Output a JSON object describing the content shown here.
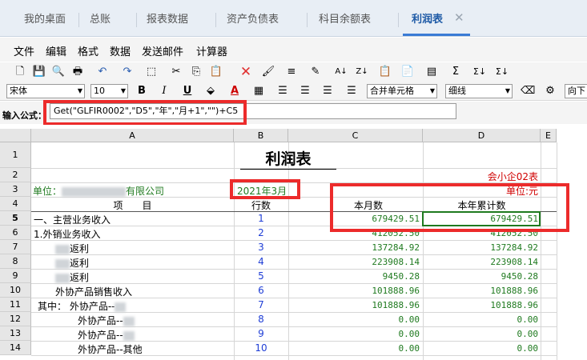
{
  "tabs": [
    {
      "label": "我的桌面"
    },
    {
      "label": "总账"
    },
    {
      "label": "报表数据"
    },
    {
      "label": "资产负债表"
    },
    {
      "label": "科目余额表"
    },
    {
      "label": "利润表",
      "active": true
    }
  ],
  "tab_close": "✕",
  "menu": [
    "文件",
    "编辑",
    "格式",
    "数据",
    "发送邮件",
    "计算器"
  ],
  "toolbar2": {
    "font": "宋体",
    "size": "10",
    "bold": "B",
    "italic": "I",
    "underline": "U",
    "merge": "合并单元格",
    "line": "细线",
    "direction": "向下"
  },
  "formula": {
    "label": "输入公式：",
    "value": "Get(\"GLFIR0002\",\"D5\",\"年\",\"月+1\",\"\")+C5"
  },
  "sheet": {
    "columns": [
      "A",
      "B",
      "C",
      "D",
      "E"
    ],
    "title": "利润表",
    "form_code": "会小企02表",
    "unit_label": "单位：",
    "unit_company_suffix": "有限公司",
    "period": "2021年3月",
    "currency_unit": "单位:元",
    "headers": {
      "item": "项　　目",
      "row_no": "行数",
      "month": "本月数",
      "ytd": "本年累计数"
    },
    "rows": [
      {
        "row": "5",
        "item": "一、主营业务收入",
        "no": "1",
        "month": "679429.51",
        "ytd": "679429.51"
      },
      {
        "row": "6",
        "item": "1.外销业务收入",
        "no": "2",
        "month": "412052.50",
        "ytd": "412052.50"
      },
      {
        "row": "7",
        "item": "返利",
        "no": "3",
        "month": "137284.92",
        "ytd": "137284.92"
      },
      {
        "row": "8",
        "item": "返利",
        "no": "4",
        "month": "223908.14",
        "ytd": "223908.14"
      },
      {
        "row": "9",
        "item": "返利",
        "no": "5",
        "month": "9450.28",
        "ytd": "9450.28"
      },
      {
        "row": "10",
        "item": "外协产品销售收入",
        "no": "6",
        "month": "101888.96",
        "ytd": "101888.96"
      },
      {
        "row": "11",
        "item": "其中：  外协产品--",
        "no": "7",
        "month": "101888.96",
        "ytd": "101888.96"
      },
      {
        "row": "12",
        "item": "外协产品--",
        "no": "8",
        "month": "0.00",
        "ytd": "0.00"
      },
      {
        "row": "13",
        "item": "外协产品--",
        "no": "9",
        "month": "0.00",
        "ytd": "0.00"
      },
      {
        "row": "14",
        "item": "外协产品--其他",
        "no": "10",
        "month": "0.00",
        "ytd": "0.00"
      }
    ],
    "row_numbers": [
      "1",
      "2",
      "3",
      "4"
    ]
  },
  "colors": {
    "red_highlight": "#ec2b2b",
    "active_tab": "#1e5aa6",
    "number_green": "#1f7a1f",
    "row_no_blue": "#1f3ed6"
  }
}
